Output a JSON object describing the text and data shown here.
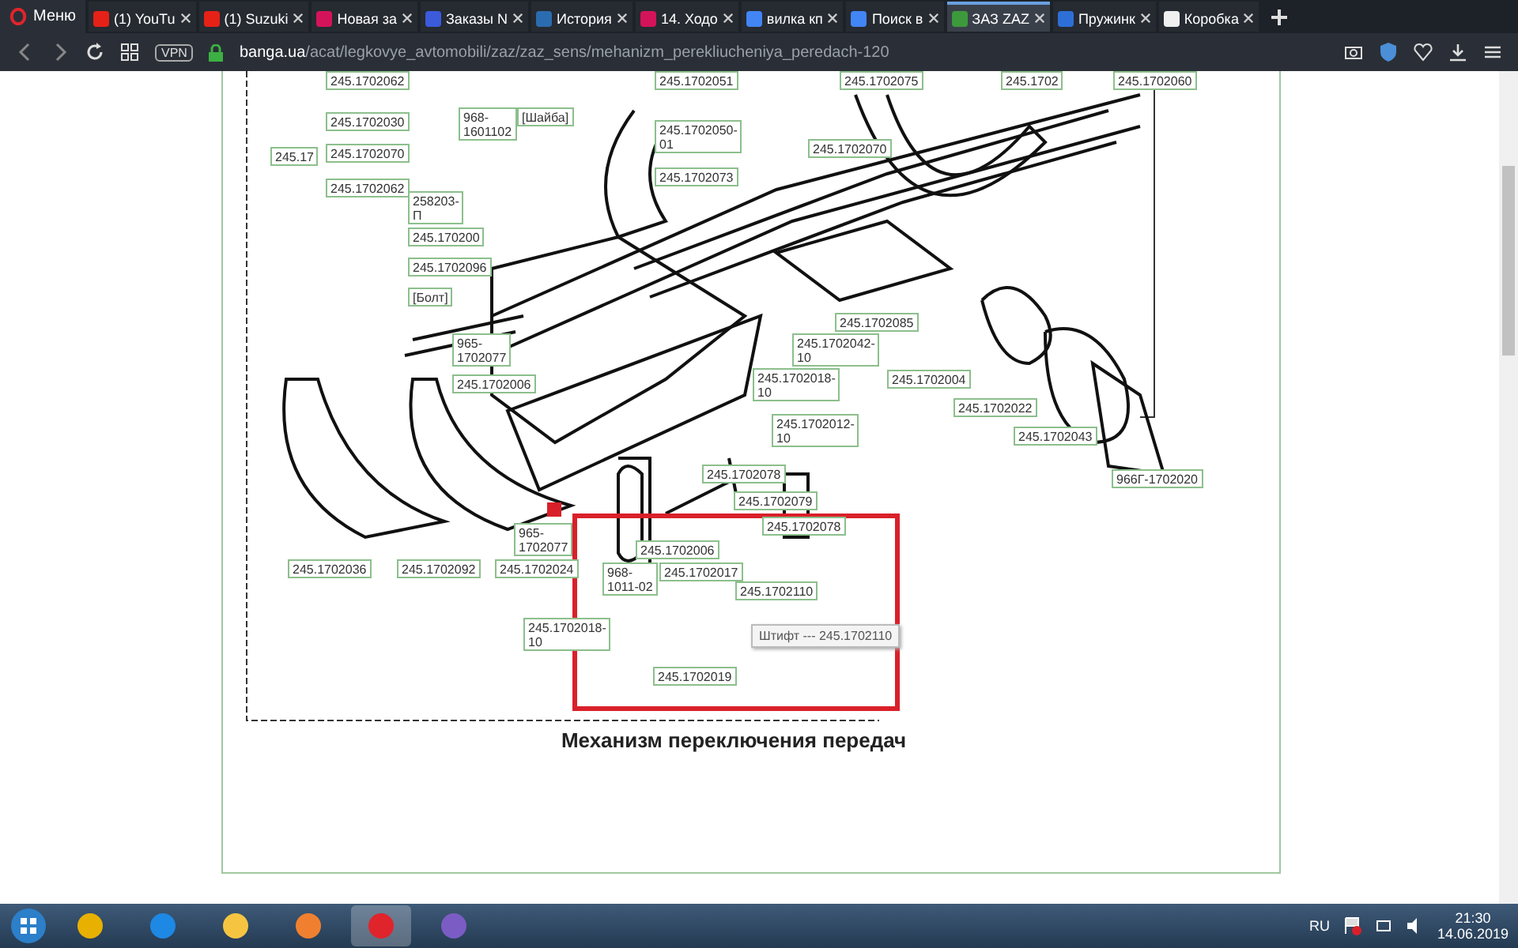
{
  "browser": {
    "menu_label": "Меню",
    "tabs": [
      {
        "title": "(1) YouTu",
        "selected": false
      },
      {
        "title": "(1) Suzuki",
        "selected": false
      },
      {
        "title": "Новая за",
        "selected": false
      },
      {
        "title": "Заказы N",
        "selected": false
      },
      {
        "title": "История",
        "selected": false
      },
      {
        "title": "14. Ходо",
        "selected": false
      },
      {
        "title": "вилка кп",
        "selected": false
      },
      {
        "title": "Поиск в",
        "selected": false
      },
      {
        "title": "ЗАЗ ZAZ",
        "selected": true
      },
      {
        "title": "Пружинк",
        "selected": false
      },
      {
        "title": "Коробка",
        "selected": false
      }
    ],
    "vpn_badge": "VPN",
    "url_host": "banga.ua",
    "url_path": "/acat/legkovye_avtomobili/zaz/zaz_sens/mehanizm_perekliucheniya_peredach-120"
  },
  "diagram": {
    "labels": [
      {
        "lines": [
          "245.1702062"
        ]
      },
      {
        "lines": [
          "245.1702030"
        ]
      },
      {
        "lines": [
          "245.17"
        ]
      },
      {
        "lines": [
          "245.1702070"
        ]
      },
      {
        "lines": [
          "245.1702062"
        ]
      },
      {
        "lines": [
          "968-",
          "1601102"
        ]
      },
      {
        "lines": [
          "[Шайба]"
        ]
      },
      {
        "lines": [
          "245.1702051"
        ]
      },
      {
        "lines": [
          "245.1702050-",
          "01"
        ]
      },
      {
        "lines": [
          "245.1702073"
        ]
      },
      {
        "lines": [
          "258203-",
          "П"
        ]
      },
      {
        "lines": [
          "245.170200"
        ]
      },
      {
        "lines": [
          "245.1702096"
        ]
      },
      {
        "lines": [
          "[Болт]"
        ]
      },
      {
        "lines": [
          "965-",
          "1702077"
        ]
      },
      {
        "lines": [
          "245.1702006"
        ]
      },
      {
        "lines": [
          "245.1702075"
        ]
      },
      {
        "lines": [
          "245.1702"
        ]
      },
      {
        "lines": [
          "245.1702060"
        ]
      },
      {
        "lines": [
          "245.1702070"
        ]
      },
      {
        "lines": [
          "245.1702085"
        ]
      },
      {
        "lines": [
          "245.1702042-",
          "10"
        ]
      },
      {
        "lines": [
          "245.1702018-",
          "10"
        ]
      },
      {
        "lines": [
          "245.1702004"
        ]
      },
      {
        "lines": [
          "245.1702022"
        ]
      },
      {
        "lines": [
          "245.1702043"
        ]
      },
      {
        "lines": [
          "966Г-1702020"
        ]
      },
      {
        "lines": [
          "245.1702012-",
          "10"
        ]
      },
      {
        "lines": [
          "245.1702078"
        ]
      },
      {
        "lines": [
          "245.1702079"
        ]
      },
      {
        "lines": [
          "245.1702078"
        ]
      },
      {
        "lines": [
          "965-",
          "1702077"
        ]
      },
      {
        "lines": [
          "245.1702006"
        ]
      },
      {
        "lines": [
          "968-",
          "1011-02"
        ]
      },
      {
        "lines": [
          "245.1702017"
        ]
      },
      {
        "lines": [
          "245.1702110"
        ]
      },
      {
        "lines": [
          "245.1702018-",
          "10"
        ]
      },
      {
        "lines": [
          "245.1702019"
        ]
      },
      {
        "lines": [
          "245.1702036"
        ]
      },
      {
        "lines": [
          "245.1702092"
        ]
      },
      {
        "lines": [
          "245.1702024"
        ]
      }
    ],
    "tooltip": "Штифт --- 245.1702110",
    "caption": "Механизм переключения передач"
  },
  "taskbar": {
    "language": "RU",
    "time": "21:30",
    "date": "14.06.2019"
  }
}
